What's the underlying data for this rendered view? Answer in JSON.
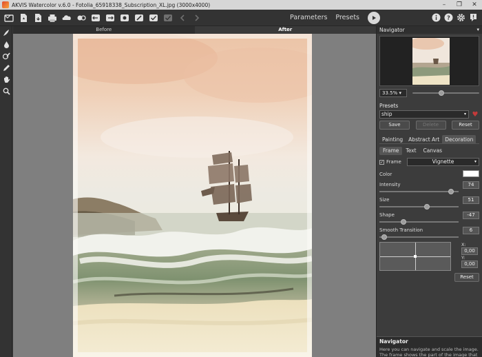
{
  "window": {
    "title": "AKVIS Watercolor v.6.0 - Fotolia_65918338_Subscription_XL.jpg (3000x4000)",
    "controls": [
      "–",
      "❐",
      "✕"
    ]
  },
  "toolbar": {
    "icons": [
      "home-icon",
      "open-icon",
      "save-icon",
      "print-icon",
      "share-icon",
      "batch-icon",
      "undo-icon",
      "redo-icon",
      "stamp-icon",
      "brush-icon",
      "eraser-icon",
      "disabled-icon",
      "back-arrow-icon",
      "forward-arrow-icon"
    ],
    "parameters_label": "Parameters",
    "presets_label": "Presets",
    "right_icons": [
      "info-icon",
      "help-icon",
      "settings-icon",
      "notification-icon"
    ]
  },
  "left_tools": [
    "smudge-icon",
    "drop-icon",
    "history-brush-icon",
    "pencil-icon",
    "hand-icon",
    "zoom-icon"
  ],
  "view": {
    "before_label": "Before",
    "after_label": "After"
  },
  "navigator": {
    "title": "Navigator",
    "zoom": "33.5%",
    "zoom_fraction": 0.43
  },
  "presets": {
    "title": "Presets",
    "selected": "ship",
    "save_label": "Save",
    "delete_label": "Delete",
    "reset_label": "Reset"
  },
  "settings_tabs": [
    "Painting",
    "Abstract Art",
    "Decoration"
  ],
  "decoration_tabs": [
    "Frame",
    "Text",
    "Canvas"
  ],
  "frame": {
    "checkbox_label": "Frame",
    "checked": true,
    "type": "Vignette",
    "color_label": "Color",
    "color": "#ffffff",
    "params": [
      {
        "label": "Intensity",
        "value": "74",
        "fraction": 0.9
      },
      {
        "label": "Size",
        "value": "51",
        "fraction": 0.6
      },
      {
        "label": "Shape",
        "value": "-47",
        "fraction": 0.3
      },
      {
        "label": "Smooth Transition",
        "value": "6",
        "fraction": 0.06
      }
    ],
    "x_label": "X:",
    "x_value": "0,00",
    "y_label": "Y:",
    "y_value": "0,00",
    "reset_label": "Reset"
  },
  "help": {
    "title": "Navigator",
    "text": "Here you can navigate and scale the image. The frame shows the part of the image that is now"
  }
}
